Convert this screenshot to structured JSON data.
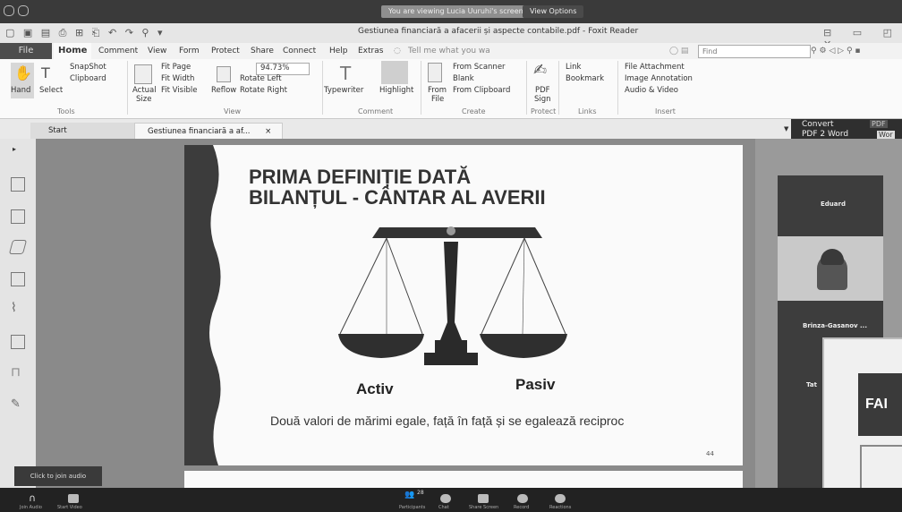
{
  "zoom": {
    "viewing_banner": "You are viewing Lucia Uuruhi's screen",
    "view_options": "View Options",
    "join_tip": "Click to join audio",
    "bottom_labels": [
      "Join Audio",
      "Start Video",
      "Participants",
      "Chat",
      "Share Screen",
      "Record",
      "Reactions"
    ],
    "participant_count": "28"
  },
  "app": {
    "title": "Gestiunea financiară a afacerii și aspecte contabile.pdf - Foxit Reader",
    "quick_access": "▢ ▣ ▤ ⎙ ⊞ ⎗ ↶ ↷ ⚲ ▾"
  },
  "ribbon": {
    "tabs": [
      "File",
      "Home",
      "Comment",
      "View",
      "Form",
      "Protect",
      "Share",
      "Connect",
      "Help",
      "Extras"
    ],
    "tell_me": "Tell me what you wa",
    "find_placeholder": "Find",
    "tools": {
      "hand": "Hand",
      "select": "Select",
      "snapshot": "SnapShot",
      "clipboard": "Clipboard",
      "group": "Tools"
    },
    "view": {
      "actual_size_1": "Actual",
      "actual_size_2": "Size",
      "fit_page": "Fit Page",
      "fit_width": "Fit Width",
      "fit_visible": "Fit Visible",
      "reflow": "Reflow",
      "zoom": "94.73%",
      "rotate_left": "Rotate Left",
      "rotate_right": "Rotate Right",
      "group": "View"
    },
    "comment": {
      "typewriter": "Typewriter",
      "highlight": "Highlight",
      "group": "Comment"
    },
    "create": {
      "from_file_1": "From",
      "from_file_2": "File",
      "from_scanner": "From Scanner",
      "blank": "Blank",
      "from_clipboard": "From Clipboard",
      "group": "Create"
    },
    "protect": {
      "pdf_sign_1": "PDF",
      "pdf_sign_2": "Sign",
      "group": "Protect"
    },
    "links": {
      "link": "Link",
      "bookmark": "Bookmark",
      "group": "Links"
    },
    "insert": {
      "file_attachment": "File Attachment",
      "image_annotation": "Image Annotation",
      "audio_video": "Audio & Video",
      "group": "Insert"
    }
  },
  "doc_tabs": {
    "start": "Start",
    "file": "Gestiunea financiară a af...",
    "close": "×"
  },
  "convert": {
    "line1": "Convert",
    "line2": "PDF 2 Word",
    "pdf": "PDF",
    "word": "Wor"
  },
  "slide": {
    "title_line1": "PRIMA DEFINIȚIE DATĂ",
    "title_line2": "BILANȚUL - CÂNTAR AL AVERII",
    "left_label": "Activ",
    "right_label": "Pasiv",
    "caption": "Două valori de mărimi egale, față în față și se egalează reciproc",
    "page_number": "44"
  },
  "participants": [
    "Eduard",
    "Brinza-Gasanov ...",
    "Tat"
  ],
  "shared_screen_text": "FAI"
}
